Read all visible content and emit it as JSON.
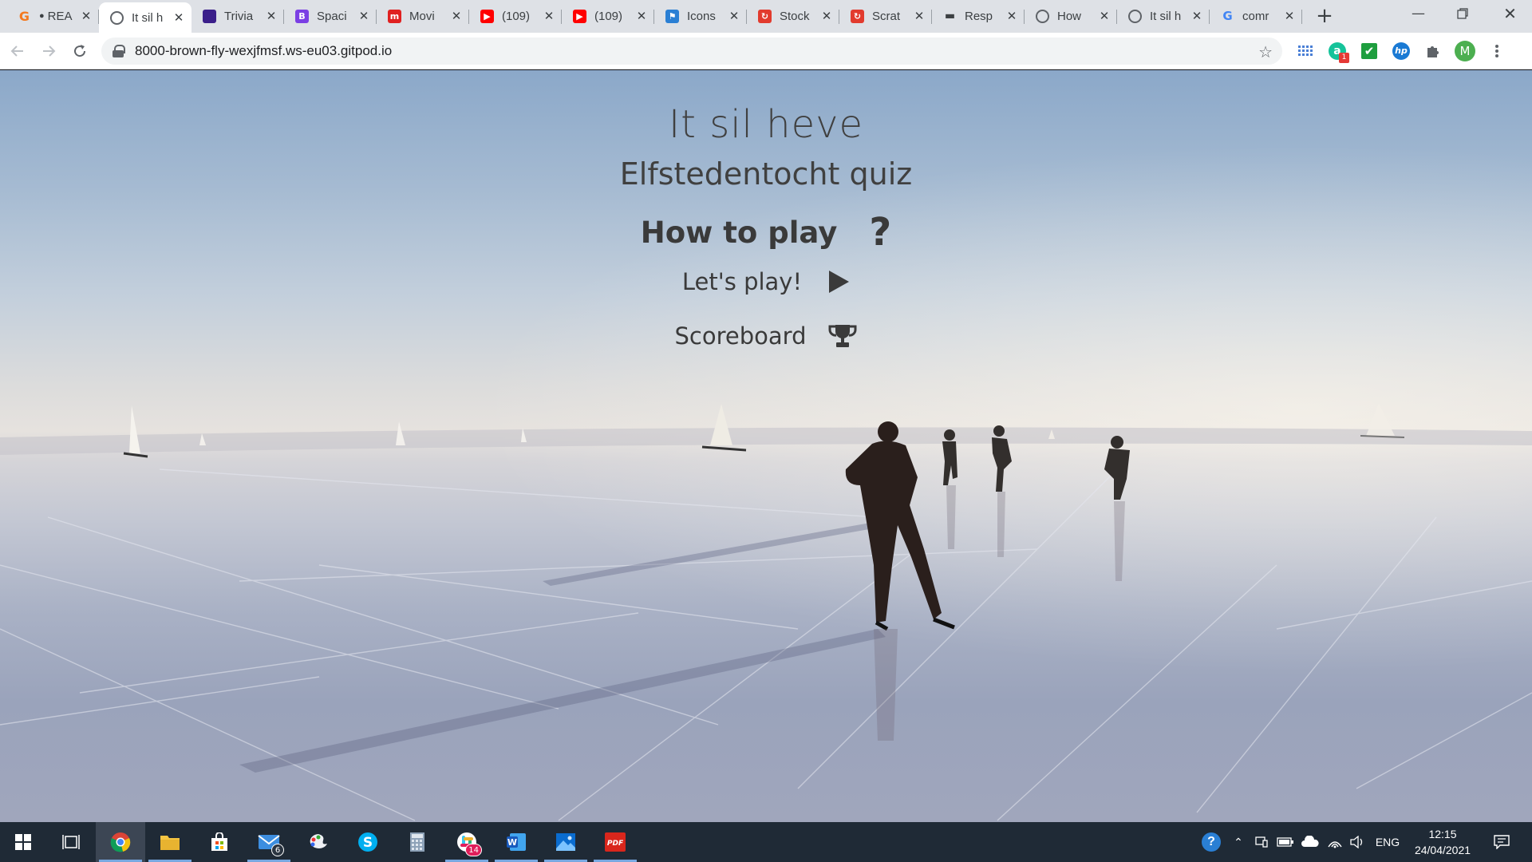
{
  "browser": {
    "tabs": [
      {
        "title": "REA",
        "prefix": "●",
        "favicon": "grammarly-icon",
        "color": "#f47a20"
      },
      {
        "title": "It sil h",
        "favicon": "globe-icon",
        "color": "#5f6368",
        "active": true
      },
      {
        "title": "Trivia",
        "favicon": "trivia-icon",
        "color": "#3b1f8a"
      },
      {
        "title": "Spaci",
        "favicon": "b-icon",
        "color": "#7b3fe4"
      },
      {
        "title": "Movi",
        "favicon": "m-icon",
        "color": "#e02020"
      },
      {
        "title": "(109)",
        "favicon": "youtube-icon",
        "color": "#ff0000"
      },
      {
        "title": "(109)",
        "favicon": "youtube-icon",
        "color": "#ff0000"
      },
      {
        "title": "Icons",
        "favicon": "flag-icon",
        "color": "#2a7fd4"
      },
      {
        "title": "Stock",
        "favicon": "pdf-icon",
        "color": "#e23b2e"
      },
      {
        "title": "Scrat",
        "favicon": "pdf-icon",
        "color": "#e23b2e"
      },
      {
        "title": "Resp",
        "favicon": "device-icon",
        "color": "#3c4043"
      },
      {
        "title": "How",
        "favicon": "globe-icon",
        "color": "#5f6368"
      },
      {
        "title": "It sil h",
        "favicon": "globe-icon",
        "color": "#5f6368"
      },
      {
        "title": "comr",
        "favicon": "google-icon",
        "color": "#4285f4"
      }
    ],
    "url": "8000-brown-fly-wexjfmsf.ws-eu03.gitpod.io",
    "profile_initial": "M",
    "extension_badge": "1"
  },
  "page": {
    "title": "It sil heve",
    "subtitle": "Elfstedentocht quiz",
    "menu": [
      {
        "label": "How to play",
        "icon": "question-icon"
      },
      {
        "label": "Let's play!",
        "icon": "play-icon"
      },
      {
        "label": "Scoreboard",
        "icon": "trophy-icon"
      }
    ]
  },
  "taskbar": {
    "apps": [
      {
        "name": "chrome",
        "icon": "chrome-icon",
        "active": true
      },
      {
        "name": "file-explorer",
        "icon": "folder-icon"
      },
      {
        "name": "store",
        "icon": "store-icon"
      },
      {
        "name": "mail",
        "icon": "mail-icon",
        "badge": "6"
      },
      {
        "name": "paint",
        "icon": "paint-icon"
      },
      {
        "name": "skype",
        "icon": "skype-icon"
      },
      {
        "name": "calculator",
        "icon": "calculator-icon"
      },
      {
        "name": "slack",
        "icon": "slack-icon",
        "badge": "14"
      },
      {
        "name": "word",
        "icon": "word-icon"
      },
      {
        "name": "photos",
        "icon": "photos-icon"
      },
      {
        "name": "pdf",
        "icon": "pdf-reader-icon"
      }
    ],
    "language": "ENG",
    "time": "12:15",
    "date": "24/04/2021"
  },
  "colors": {
    "text": "#404040",
    "taskbar": "#1f2a36",
    "tabstrip": "#dee1e6"
  }
}
